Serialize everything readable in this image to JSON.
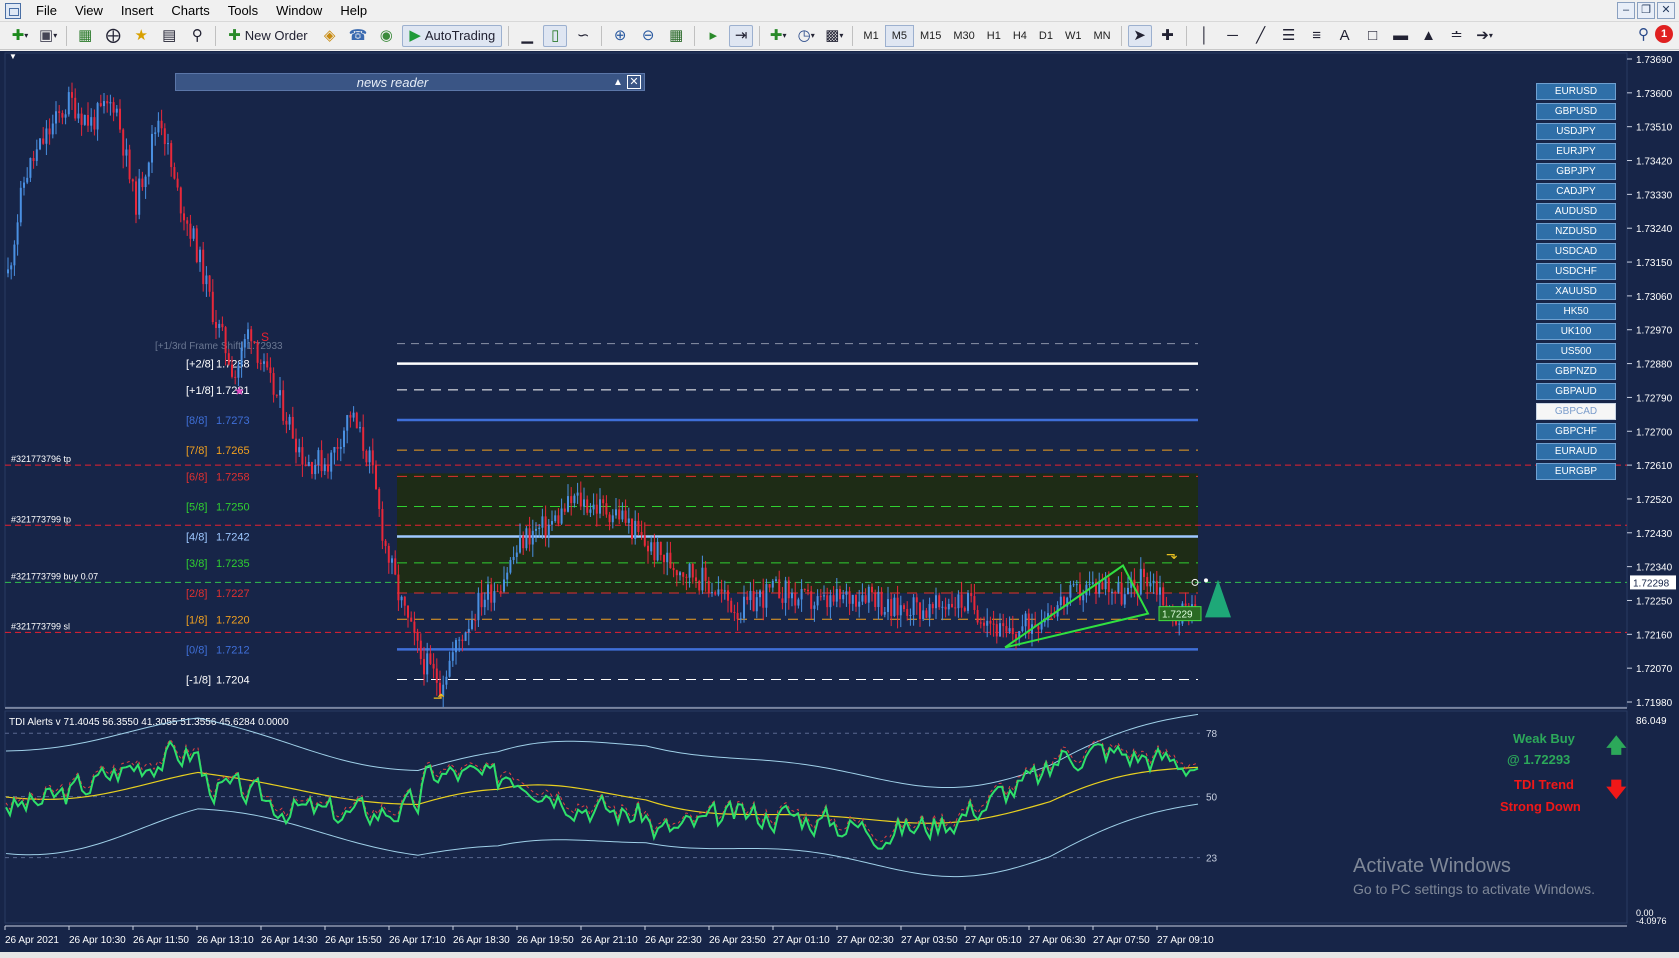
{
  "menubar": {
    "items": [
      "File",
      "View",
      "Insert",
      "Charts",
      "Tools",
      "Window",
      "Help"
    ]
  },
  "toolbar": {
    "new_order": "New Order",
    "auto_trading": "AutoTrading",
    "timeframes": [
      "M1",
      "M5",
      "M15",
      "M30",
      "H1",
      "H4",
      "D1",
      "W1",
      "MN"
    ],
    "active_timeframe": "M5",
    "notification_count": "1"
  },
  "news_reader": {
    "title": "news reader"
  },
  "symbols": [
    "EURUSD",
    "GBPUSD",
    "USDJPY",
    "EURJPY",
    "GBPJPY",
    "CADJPY",
    "AUDUSD",
    "NZDUSD",
    "USDCAD",
    "USDCHF",
    "XAUUSD",
    "HK50",
    "UK100",
    "US500",
    "GBPNZD",
    "GBPAUD",
    "GBPCAD",
    "GBPCHF",
    "EURAUD",
    "EURGBP"
  ],
  "active_symbol": "GBPCAD",
  "price_axis": [
    "1.73690",
    "1.73600",
    "1.73510",
    "1.73420",
    "1.73330",
    "1.73240",
    "1.73150",
    "1.73060",
    "1.72970",
    "1.72880",
    "1.72790",
    "1.72700",
    "1.72610",
    "1.72520",
    "1.72430",
    "1.72340",
    "1.72250",
    "1.72160",
    "1.72070",
    "1.71980"
  ],
  "current_price": "1.72298",
  "murrey_levels": [
    {
      "label": "[+2/8]",
      "value": "1.7288",
      "color": "#ffffff"
    },
    {
      "label": "[+1/8]",
      "value": "1.7281",
      "color": "#ffffff"
    },
    {
      "label": "[8/8]",
      "value": "1.7273",
      "color": "#3f6fd8"
    },
    {
      "label": "[7/8]",
      "value": "1.7265",
      "color": "#f0a020"
    },
    {
      "label": "[6/8]",
      "value": "1.7258",
      "color": "#e03030"
    },
    {
      "label": "[5/8]",
      "value": "1.7250",
      "color": "#30d030"
    },
    {
      "label": "[4/8]",
      "value": "1.7242",
      "color": "#9ec8ff"
    },
    {
      "label": "[3/8]",
      "value": "1.7235",
      "color": "#30d030"
    },
    {
      "label": "[2/8]",
      "value": "1.7227",
      "color": "#e03030"
    },
    {
      "label": "[1/8]",
      "value": "1.7220",
      "color": "#f0a020"
    },
    {
      "label": "[0/8]",
      "value": "1.7212",
      "color": "#3f6fd8"
    },
    {
      "label": "[-1/8]",
      "value": "1.7204",
      "color": "#ffffff"
    }
  ],
  "frame_shift": "[+1/3rd Frame Shift] 1.72933",
  "order_labels": {
    "tp1": "#321773796 tp",
    "tp2": "#321773799 tp",
    "buy": "#321773799 buy 0.07",
    "sl": "#321773799 sl"
  },
  "price_box_label": "1.7229",
  "indicator": {
    "header": "TDI Alerts v 71.4045 56.3550 41.3055 51.3556 45.6284 0.0000",
    "levels": [
      "78",
      "50",
      "23"
    ],
    "axis_top": "86.049",
    "axis_bottom": "-4.0976",
    "axis_mid": "0.00"
  },
  "tdi_panel": {
    "signal": "Weak Buy",
    "price": "@ 1.72293",
    "trend_title": "TDI Trend",
    "trend_value": "Strong Down",
    "up_color": "#2ca85a",
    "down_color": "#f01818"
  },
  "time_axis": [
    "26 Apr 2021",
    "26 Apr 10:30",
    "26 Apr 11:50",
    "26 Apr 13:10",
    "26 Apr 14:30",
    "26 Apr 15:50",
    "26 Apr 17:10",
    "26 Apr 18:30",
    "26 Apr 19:50",
    "26 Apr 21:10",
    "26 Apr 22:30",
    "26 Apr 23:50",
    "27 Apr 01:10",
    "27 Apr 02:30",
    "27 Apr 03:50",
    "27 Apr 05:10",
    "27 Apr 06:30",
    "27 Apr 07:50",
    "27 Apr 09:10"
  ],
  "watermark": {
    "title": "Activate Windows",
    "subtitle": "Go to PC settings to activate Windows."
  },
  "colors": {
    "background": "#172548",
    "bull_candle": "#4a90e2",
    "bear_candle": "#e8283a",
    "tdi_green": "#2fe06a",
    "tdi_yellow": "#e8d020",
    "tdi_band": "#9fd0e8"
  }
}
